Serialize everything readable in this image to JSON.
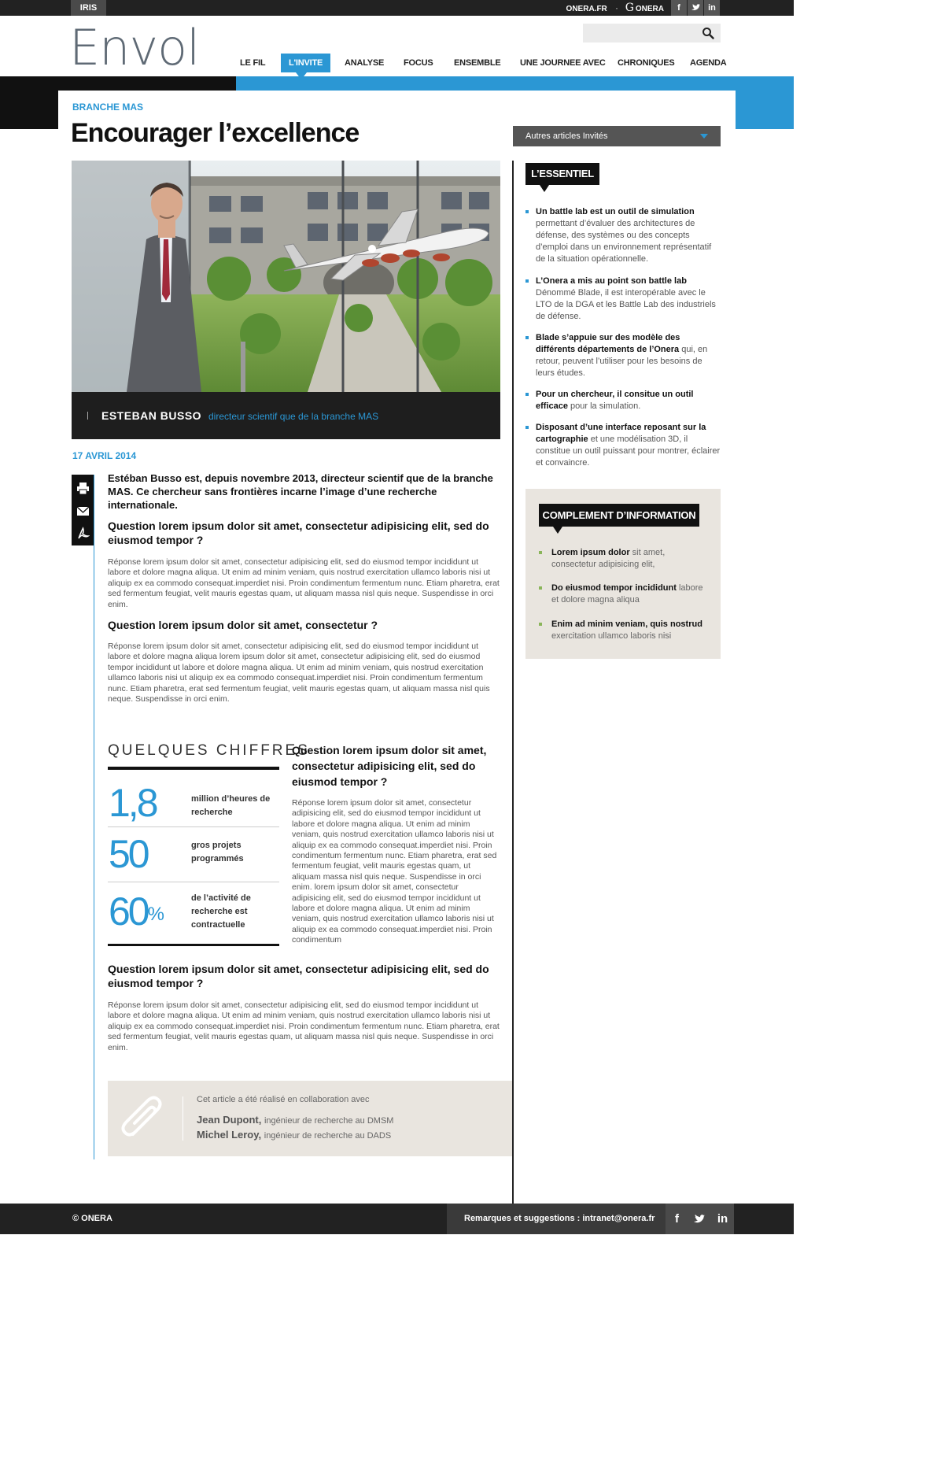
{
  "topbar": {
    "section_tab": "IRIS",
    "link_onera_fr": "ONERA.FR",
    "link_g_mark": "G",
    "link_onera": "ONERA",
    "social": [
      "f",
      "t",
      "in"
    ]
  },
  "header": {
    "logo": "Envol",
    "search_placeholder": ""
  },
  "nav": {
    "items": [
      "LE FIL",
      "L'INVITE",
      "ANALYSE",
      "FOCUS",
      "ENSEMBLE",
      "UNE JOURNEE AVEC",
      "CHRONIQUES",
      "AGENDA"
    ],
    "active_index": 1
  },
  "article": {
    "kicker": "BRANCHE MAS",
    "title": "Encourager l’excellence",
    "photo_caption_name": "ESTEBAN BUSSO",
    "photo_caption_role": "directeur scientif que de la branche MAS",
    "date": "17 AVRIL 2014",
    "lead": "Estéban Busso est, depuis novembre 2013, directeur scientif que de la branche MAS. Ce chercheur sans frontières incarne l’image d’une recherche internationale.",
    "q1": "Question lorem ipsum dolor sit amet, consectetur adipisicing elit, sed do eiusmod tempor ?",
    "p1": "Réponse lorem ipsum dolor sit amet, consectetur adipisicing elit, sed do eiusmod tempor incididunt ut labore et dolore magna aliqua. Ut enim ad minim veniam, quis nostrud exercitation ullamco laboris nisi ut aliquip ex ea commodo consequat.imperdiet nisi. Proin condimentum fermentum nunc. Etiam pharetra, erat sed fermentum feugiat, velit mauris egestas quam, ut aliquam massa nisl quis neque. Suspendisse in orci enim.",
    "q2": "Question lorem ipsum dolor sit amet, consectetur ?",
    "p2": "Réponse lorem ipsum dolor sit amet, consectetur adipisicing elit, sed do eiusmod tempor incididunt ut labore et dolore magna aliqua lorem ipsum dolor sit amet, consectetur adipisicing elit, sed do eiusmod tempor incididunt ut labore et dolore magna aliqua. Ut enim ad minim veniam, quis nostrud exercitation ullamco laboris nisi ut aliquip ex ea commodo consequat.imperdiet nisi. Proin condimentum fermentum nunc. Etiam pharetra, erat sed fermentum feugiat, velit mauris egestas quam, ut aliquam massa nisl quis neque. Suspendisse in orci enim.",
    "q3": "Question lorem ipsum dolor sit amet, consectetur adipisicing elit, sed do eiusmod tempor ?",
    "p3": "Réponse lorem ipsum dolor sit amet, consectetur adipisicing elit, sed do eiusmod tempor incididunt ut labore et dolore magna aliqua. Ut enim ad minim veniam, quis nostrud exercitation ullamco laboris nisi ut aliquip ex ea commodo consequat.imperdiet nisi. Proin condimentum fermentum nunc. Etiam pharetra, erat sed fermentum feugiat, velit mauris egestas quam, ut aliquam massa nisl quis neque. Suspendisse in orci enim. lorem ipsum dolor sit amet, consectetur adipisicing elit, sed do eiusmod tempor incididunt ut labore et dolore magna aliqua. Ut enim ad minim veniam, quis nostrud exercitation ullamco laboris nisi ut aliquip ex ea commodo consequat.imperdiet nisi. Proin condimentum",
    "q4": "Question lorem ipsum dolor sit amet, consectetur adipisicing elit, sed do eiusmod tempor ?",
    "p4": "Réponse lorem ipsum dolor sit amet, consectetur adipisicing elit, sed do eiusmod tempor incididunt ut labore et dolore magna aliqua. Ut enim ad minim veniam, quis nostrud exercitation ullamco laboris nisi ut aliquip ex ea commodo consequat.imperdiet nisi. Proin condimentum fermentum nunc. Etiam pharetra, erat sed fermentum feugiat, velit mauris egestas quam, ut aliquam massa nisl quis neque. Suspendisse in orci enim."
  },
  "figures": {
    "title": "QUELQUES CHIFFRES",
    "items": [
      {
        "value": "1,8",
        "suffix": "",
        "label": "million d’heures de recherche"
      },
      {
        "value": "50",
        "suffix": "",
        "label": "gros projets programmés"
      },
      {
        "value": "60",
        "suffix": "%",
        "label": "de l’activité de recherche est contractuelle"
      }
    ]
  },
  "collaboration": {
    "intro": "Cet article a été réalisé en collaboration avec",
    "people": [
      {
        "name": "Jean Dupont,",
        "role": "ingénieur de recherche au DMSM"
      },
      {
        "name": "Michel Leroy,",
        "role": "ingénieur de recherche au DADS"
      }
    ]
  },
  "sidebar": {
    "dropdown_label": "Autres articles Invités",
    "essentiel_title": "L’ESSENTIEL",
    "essentiel": [
      {
        "bold": "Un battle lab est un outil de simulation",
        "text": " permettant d’évaluer des architectures de défense, des systèmes ou des concepts d’emploi dans un environnement représentatif de la situation opérationnelle."
      },
      {
        "bold": "L’Onera a mis au point son battle lab",
        "text": " Dénommé Blade, il est interopérable avec le LTO de la DGA et les Battle Lab des industriels de défense."
      },
      {
        "bold": "Blade s’appuie sur des modèle des différents départements de l’Onera",
        "text": " qui, en retour, peuvent l’utiliser pour les besoins de leurs études."
      },
      {
        "bold": "Pour un chercheur, il consitue un outil efficace",
        "text": " pour la simulation."
      },
      {
        "bold": "Disposant d’une interface reposant sur la cartographie",
        "text": " et une modélisation 3D, il constitue un outil puissant pour montrer, éclairer et convaincre."
      }
    ],
    "complement_title": "COMPLEMENT D’INFORMATION",
    "complement": [
      {
        "bold": "Lorem ipsum dolor",
        "text": " sit amet, consectetur adipisicing elit,"
      },
      {
        "bold": "Do eiusmod tempor incididunt",
        "text": " labore et dolore magna aliqua"
      },
      {
        "bold": "Enim ad minim veniam, quis nostrud",
        "text": " exercitation ullamco laboris nisi"
      }
    ]
  },
  "footer": {
    "copyright": "© ONERA",
    "remarks": "Remarques et suggestions : intranet@onera.fr",
    "social": [
      "f",
      "t",
      "in"
    ]
  },
  "colors": {
    "accent": "#2b97d4",
    "dark": "#111111",
    "panel": "#e9e5df",
    "bullet_green": "#8ab55a"
  }
}
